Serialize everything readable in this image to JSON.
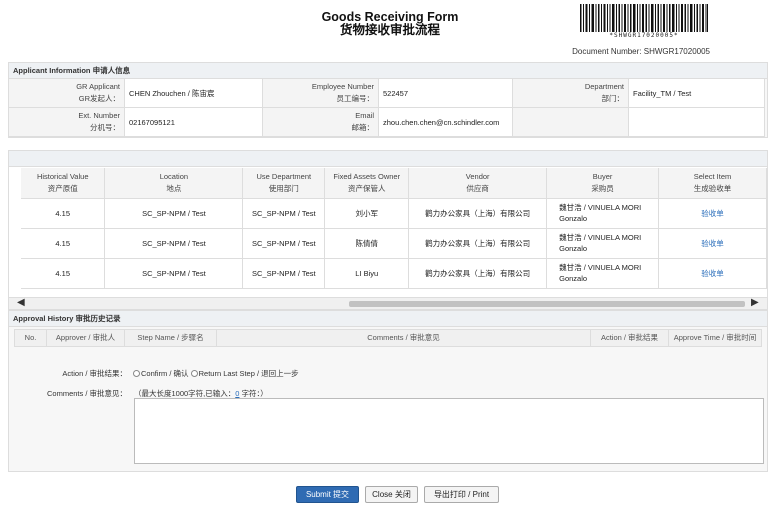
{
  "header": {
    "title_en": "Goods Receiving Form",
    "title_zh": "货物接收审批流程",
    "barcode_text": "*SHWGR17020005*",
    "document_number": "Document Number: SHWGR17020005"
  },
  "applicant": {
    "section_title": "Applicant Information 申请人信息",
    "gr_applicant_label_en": "GR Applicant",
    "gr_applicant_label_zh": "GR发起人：",
    "gr_applicant_value": "CHEN Zhouchen / 陈宙宸",
    "employee_number_label_en": "Employee Number",
    "employee_number_label_zh": "员工编号：",
    "employee_number_value": "522457",
    "department_label_en": "Department",
    "department_label_zh": "部门：",
    "department_value": "Facility_TM / Test",
    "ext_number_label_en": "Ext. Number",
    "ext_number_label_zh": "分机号：",
    "ext_number_value": "02167095121",
    "email_label_en": "Email",
    "email_label_zh": "邮箱：",
    "email_value": "zhou.chen.chen@cn.schindler.com"
  },
  "items": {
    "columns": [
      {
        "en": "Historical Value",
        "zh": "资产原值"
      },
      {
        "en": "Location",
        "zh": "地点"
      },
      {
        "en": "Use Department",
        "zh": "使用部门"
      },
      {
        "en": "Fixed Assets Owner",
        "zh": "资产保管人"
      },
      {
        "en": "Vendor",
        "zh": "供应商"
      },
      {
        "en": "Buyer",
        "zh": "采购员"
      },
      {
        "en": "Select Item",
        "zh": "生成验收单"
      }
    ],
    "rows": [
      {
        "value": "4.15",
        "location": "SC_SP-NPM / Test",
        "use_dept": "SC_SP-NPM / Test",
        "owner": "刘小军",
        "vendor": "鹳力办公家具（上海）有限公司",
        "buyer_line1": "魏甘浩 / VINUELA MORI",
        "buyer_line2": "Gonzalo",
        "select": "验收单"
      },
      {
        "value": "4.15",
        "location": "SC_SP-NPM / Test",
        "use_dept": "SC_SP-NPM / Test",
        "owner": "陈倩倩",
        "vendor": "鹳力办公家具（上海）有限公司",
        "buyer_line1": "魏甘浩 / VINUELA MORI",
        "buyer_line2": "Gonzalo",
        "select": "验收单"
      },
      {
        "value": "4.15",
        "location": "SC_SP-NPM / Test",
        "use_dept": "SC_SP-NPM / Test",
        "owner": "LI Biyu",
        "vendor": "鹳力办公家具（上海）有限公司",
        "buyer_line1": "魏甘浩 / VINUELA MORI",
        "buyer_line2": "Gonzalo",
        "select": "验收单"
      }
    ]
  },
  "approval": {
    "section_title": "Approval History 审批历史记录",
    "columns": [
      "No.",
      "Approver / 审批人",
      "Step Name / 步骤名",
      "Comments / 审批意见",
      "Action / 审批结果",
      "Approve Time / 审批时间"
    ],
    "action_label": "Action / 审批结果：",
    "option_confirm": "Confirm / 确认",
    "option_return": "Return Last Step / 退回上一步",
    "comments_label": "Comments / 审批意见：",
    "hint_prefix": "（最大长度1000字符,已输入：",
    "hint_count": "0",
    "hint_suffix": " 字符：）"
  },
  "buttons": {
    "submit": "Submit 提交",
    "close": "Close 关闭",
    "print": "导出打印 / Print"
  },
  "colors": {
    "primary_button": "#2f6bb3",
    "link": "#2a6ebb"
  },
  "icons": {
    "scroll_left": "◀",
    "scroll_right": "▶"
  }
}
